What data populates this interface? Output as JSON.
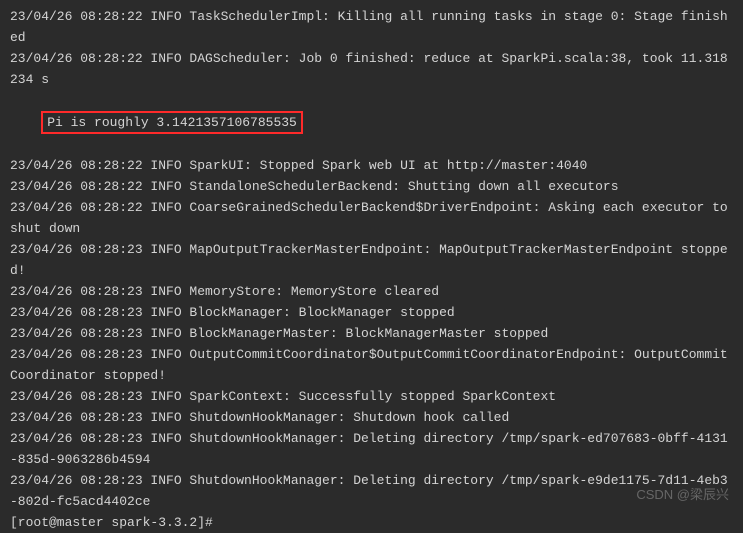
{
  "lines": [
    "23/04/26 08:28:22 INFO TaskSchedulerImpl: Killing all running tasks in stage 0: Stage finished",
    "23/04/26 08:28:22 INFO DAGScheduler: Job 0 finished: reduce at SparkPi.scala:38, took 11.318234 s"
  ],
  "highlight": "Pi is roughly 3.1421357106785535",
  "lines_after": [
    "23/04/26 08:28:22 INFO SparkUI: Stopped Spark web UI at http://master:4040",
    "23/04/26 08:28:22 INFO StandaloneSchedulerBackend: Shutting down all executors",
    "23/04/26 08:28:22 INFO CoarseGrainedSchedulerBackend$DriverEndpoint: Asking each executor to shut down",
    "23/04/26 08:28:23 INFO MapOutputTrackerMasterEndpoint: MapOutputTrackerMasterEndpoint stopped!",
    "23/04/26 08:28:23 INFO MemoryStore: MemoryStore cleared",
    "23/04/26 08:28:23 INFO BlockManager: BlockManager stopped",
    "23/04/26 08:28:23 INFO BlockManagerMaster: BlockManagerMaster stopped",
    "23/04/26 08:28:23 INFO OutputCommitCoordinator$OutputCommitCoordinatorEndpoint: OutputCommitCoordinator stopped!",
    "23/04/26 08:28:23 INFO SparkContext: Successfully stopped SparkContext",
    "23/04/26 08:28:23 INFO ShutdownHookManager: Shutdown hook called",
    "23/04/26 08:28:23 INFO ShutdownHookManager: Deleting directory /tmp/spark-ed707683-0bff-4131-835d-9063286b4594",
    "23/04/26 08:28:23 INFO ShutdownHookManager: Deleting directory /tmp/spark-e9de1175-7d11-4eb3-802d-fc5acd4402ce"
  ],
  "prompt": "[root@master spark-3.3.2]#",
  "watermark": "CSDN @梁辰兴"
}
